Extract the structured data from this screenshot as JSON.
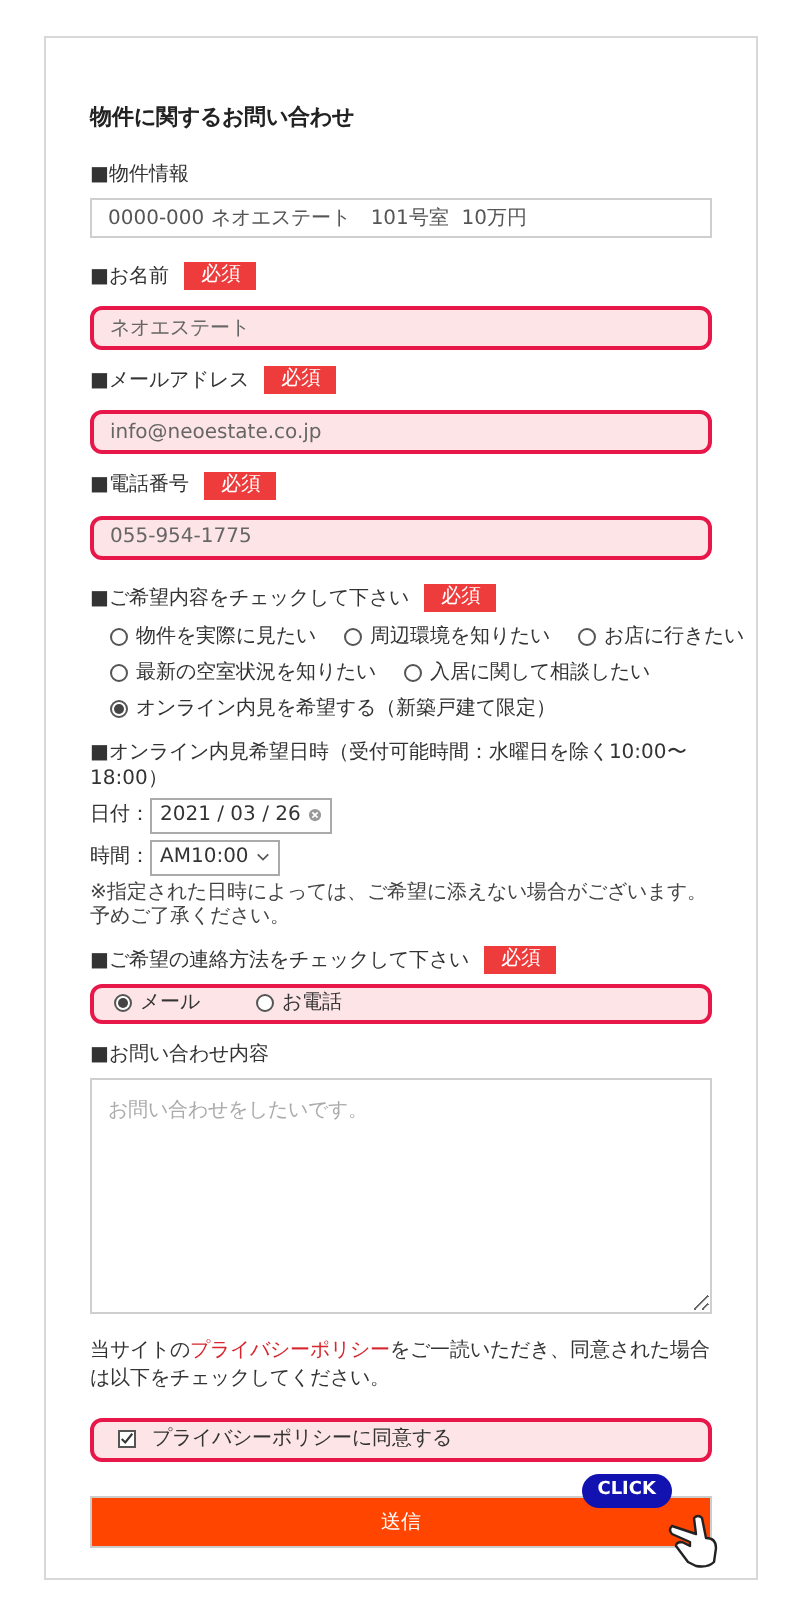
{
  "title": "物件に関するお問い合わせ",
  "property": {
    "label": "■物件情報",
    "value": "0000-000 ネオエステート　101号室  10万円"
  },
  "inputs": [
    {
      "label": "■お名前",
      "badge": "必須",
      "value": "ネオエステート",
      "highlighted": true
    },
    {
      "label": "■メールアドレス",
      "badge": "必須",
      "value": "info@neoestate.co.jp",
      "highlighted": true
    },
    {
      "label": "■電話番号",
      "badge": "必須",
      "value": "055-954-1775",
      "highlighted": true
    }
  ],
  "wishes": {
    "label": "■ご希望内容をチェックして下さい",
    "badge": "必須",
    "rows": [
      [
        {
          "label": "物件を実際に見たい",
          "selected": false
        },
        {
          "label": "周辺環境を知りたい",
          "selected": false
        },
        {
          "label": "お店に行きたい",
          "selected": false
        }
      ],
      [
        {
          "label": "最新の空室状況を知りたい",
          "selected": false
        },
        {
          "label": "入居に関して相談したい",
          "selected": false
        }
      ],
      [
        {
          "label": "オンライン内見を希望する（新築戸建て限定）",
          "selected": true
        }
      ]
    ]
  },
  "viewing": {
    "label": "■オンライン内見希望日時（受付可能時間：水曜日を除く10:00〜18:00）",
    "date_label": "日付：",
    "date": "2021 / 03 / 26",
    "time_label": "時間：",
    "time": "AM10:00",
    "note": "※指定された日時によっては、ご希望に添えない場合がございます。予めご了承ください。"
  },
  "contact": {
    "label": "■ご希望の連絡方法をチェックして下さい",
    "badge": "必須",
    "highlighted": true,
    "options": [
      {
        "label": "メール",
        "selected": true
      },
      {
        "label": "お電話",
        "selected": false
      }
    ]
  },
  "message": {
    "label": "■お問い合わせ内容",
    "placeholder": "お問い合わせをしたいです。"
  },
  "privacy": {
    "before": "当サイトの",
    "link": "プライバシーポリシー",
    "after": "をご一読いただき、同意された場合は以下をチェックしてください。"
  },
  "agree": {
    "label": "プライバシーポリシーに同意する",
    "checked": true,
    "highlighted": true
  },
  "submit": {
    "label": "送信",
    "callout": "CLICK"
  }
}
